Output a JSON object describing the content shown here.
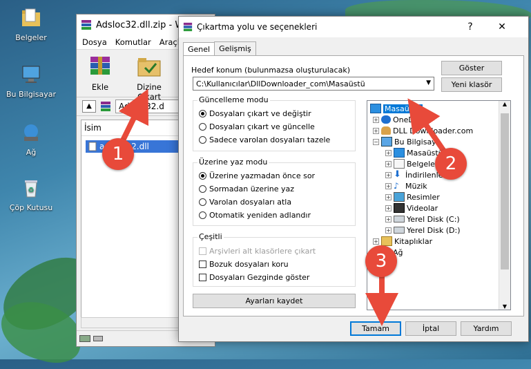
{
  "desktop": {
    "icons": [
      {
        "label": "Belgeler",
        "icon": "folder-icon"
      },
      {
        "label": "Bu Bilgisayar",
        "icon": "computer-icon"
      },
      {
        "label": "Ağ",
        "icon": "network-icon"
      },
      {
        "label": "Çöp Kutusu",
        "icon": "recycle-bin-icon"
      }
    ]
  },
  "winrar": {
    "title": "Adsloc32.dll.zip - W",
    "menu": [
      "Dosya",
      "Komutlar",
      "Araçla"
    ],
    "tools": [
      {
        "label": "Ekle"
      },
      {
        "label": "Dizine Çıkart"
      }
    ],
    "path": "Adsloc32.d",
    "column_name": "İsim",
    "file": "adsloc32.dll"
  },
  "dialog": {
    "title": "Çıkartma yolu ve seçenekleri",
    "help_glyph": "?",
    "close_glyph": "✕",
    "tabs": [
      "Genel",
      "Gelişmiş"
    ],
    "dest_label": "Hedef konum (bulunmazsa oluşturulacak)",
    "dest_value": "C:\\Kullanıcılar\\DllDownloader_com\\Masaüstü",
    "show_button": "Göster",
    "new_folder_button": "Yeni klasör",
    "update_mode": {
      "title": "Güncelleme modu",
      "options": [
        "Dosyaları çıkart ve değiştir",
        "Dosyaları çıkart ve güncelle",
        "Sadece varolan dosyaları tazele"
      ],
      "selected": 0
    },
    "overwrite_mode": {
      "title": "Üzerine yaz modu",
      "options": [
        "Üzerine yazmadan önce sor",
        "Sormadan üzerine yaz",
        "Varolan dosyaları atla",
        "Otomatik yeniden adlandır"
      ],
      "selected": 0
    },
    "misc": {
      "title": "Çeşitli",
      "options": [
        "Arşivleri alt klasörlere çıkart",
        "Bozuk dosyaları koru",
        "Dosyaları Gezginde göster"
      ]
    },
    "save_settings_button": "Ayarları kaydet",
    "tree": [
      {
        "label": "Masaüstü",
        "icon": "desktop-icon",
        "selected": true
      },
      {
        "label": "OneD",
        "icon": "onedrive-icon"
      },
      {
        "label": "DLL Downloader.com",
        "icon": "user-icon"
      },
      {
        "label": "Bu Bilgisaya",
        "icon": "computer-icon"
      },
      {
        "label": "Masaüstü",
        "icon": "desktop-icon"
      },
      {
        "label": "Belgeler",
        "icon": "documents-icon"
      },
      {
        "label": "İndirilenler",
        "icon": "download-icon"
      },
      {
        "label": "Müzik",
        "icon": "music-icon"
      },
      {
        "label": "Resimler",
        "icon": "pictures-icon"
      },
      {
        "label": "Videolar",
        "icon": "videos-icon"
      },
      {
        "label": "Yerel Disk (C:)",
        "icon": "drive-icon"
      },
      {
        "label": "Yerel Disk (D:)",
        "icon": "drive-icon"
      },
      {
        "label": "Kitaplıklar",
        "icon": "libraries-icon"
      },
      {
        "label": "Ağ",
        "icon": "network-icon"
      }
    ],
    "ok_button": "Tamam",
    "cancel_button": "İptal",
    "help_button": "Yardım"
  },
  "annotations": [
    "1",
    "2",
    "3"
  ],
  "colors": {
    "badge": "#e84a3a",
    "selection": "#0078d7"
  }
}
